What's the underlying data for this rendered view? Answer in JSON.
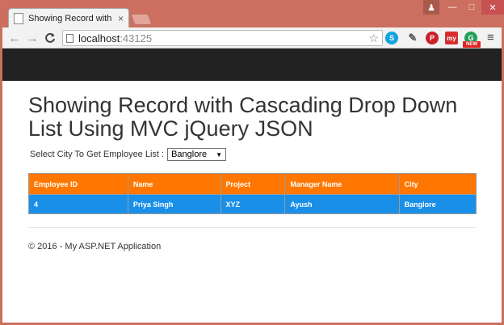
{
  "browser": {
    "tab_title": "Showing Record with Cascading Drop Down List Using MVC jQuery JSON",
    "tab_close": "×",
    "url_host": "localhost",
    "url_port": ":43125",
    "window_controls": {
      "user": "♟",
      "minimize": "—",
      "maximize": "□",
      "close": "✕"
    },
    "nav": {
      "back": "←",
      "forward": "→",
      "reload": "C",
      "star": "☆",
      "menu": "≡"
    },
    "extensions": {
      "skype": "S",
      "pinterest": "P",
      "my": "my",
      "g": "G",
      "new_badge": "NEW"
    }
  },
  "page": {
    "heading": "Showing Record with Cascading Drop Down List Using MVC jQuery JSON",
    "filter_label": "Select City To Get Employee List :",
    "city_select_value": "Banglore",
    "table": {
      "headers": [
        "Employee ID",
        "Name",
        "Project",
        "Manager Name",
        "City"
      ],
      "rows": [
        [
          "4",
          "Priya Singh",
          "XYZ",
          "Ayush",
          "Banglore"
        ]
      ]
    },
    "footer": "© 2016 - My ASP.NET Application"
  },
  "colors": {
    "header_bg": "#ff7700",
    "row_bg": "#1a8fe8",
    "navbar_bg": "#222222",
    "window_frame": "#cc6f60"
  }
}
